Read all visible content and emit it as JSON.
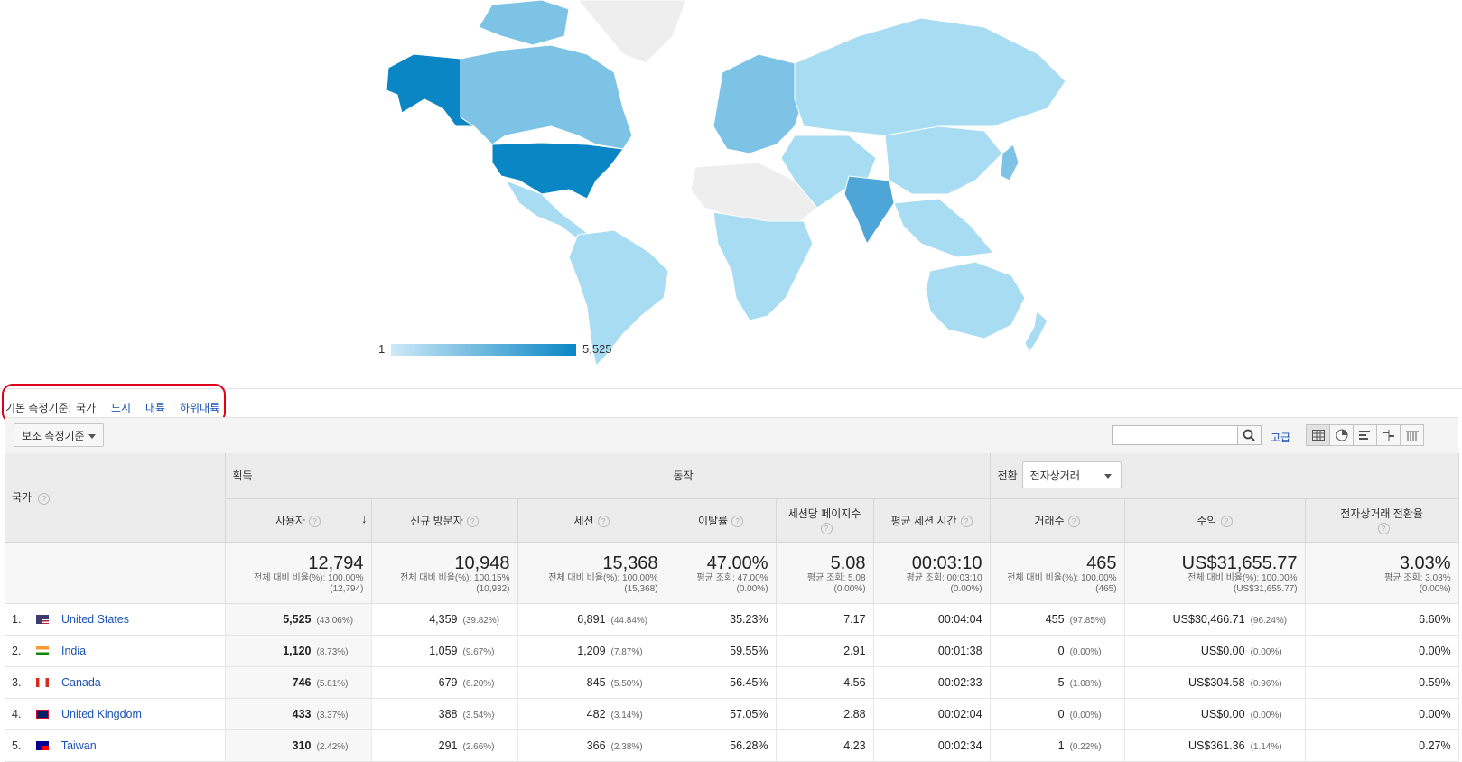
{
  "map": {
    "legend_min": "1",
    "legend_max": "5,525",
    "colors": {
      "low": "#cde9f7",
      "mid": "#7cc3e6",
      "high": "#0a86c5",
      "none": "#eeeeee"
    }
  },
  "primary_dimension": {
    "label": "기본 측정기준:",
    "current": "국가",
    "options": [
      "도시",
      "대륙",
      "하위대륙"
    ]
  },
  "toolbar": {
    "secondary_dimension": "보조 측정기준",
    "search_placeholder": "",
    "advanced": "고급"
  },
  "table": {
    "dimension_header": "국가",
    "groups": [
      "획득",
      "동작",
      "전환"
    ],
    "conversion_select": "전자상거래",
    "columns": [
      "사용자",
      "신규 방문자",
      "세션",
      "이탈률",
      "세션당 페이지수",
      "평균 세션 시간",
      "거래수",
      "수익",
      "전자상거래 전환율"
    ],
    "totals": [
      {
        "value": "12,794",
        "sub1": "전체 대비 비율(%): 100.00%",
        "sub2": "(12,794)"
      },
      {
        "value": "10,948",
        "sub1": "전체 대비 비율(%): 100.15%",
        "sub2": "(10,932)"
      },
      {
        "value": "15,368",
        "sub1": "전체 대비 비율(%): 100.00%",
        "sub2": "(15,368)"
      },
      {
        "value": "47.00%",
        "sub1": "평균 조회: 47.00%",
        "sub2": "(0.00%)"
      },
      {
        "value": "5.08",
        "sub1": "평균 조회: 5.08",
        "sub2": "(0.00%)"
      },
      {
        "value": "00:03:10",
        "sub1": "평균 조회: 00:03:10",
        "sub2": "(0.00%)"
      },
      {
        "value": "465",
        "sub1": "전체 대비 비율(%): 100.00%",
        "sub2": "(465)"
      },
      {
        "value": "US$31,655.77",
        "sub1": "전체 대비 비율(%): 100.00%",
        "sub2": "(US$31,655.77)"
      },
      {
        "value": "3.03%",
        "sub1": "평균 조회: 3.03%",
        "sub2": "(0.00%)"
      }
    ],
    "rows": [
      {
        "rank": "1.",
        "country": "United States",
        "flag": "us",
        "users": "5,525",
        "users_pct": "(43.06%)",
        "new": "4,359",
        "new_pct": "(39.82%)",
        "sessions": "6,891",
        "sessions_pct": "(44.84%)",
        "bounce": "35.23%",
        "pages": "7.17",
        "duration": "00:04:04",
        "transactions": "455",
        "transactions_pct": "(97.85%)",
        "revenue": "US$30,466.71",
        "revenue_pct": "(96.24%)",
        "conversion": "6.60%"
      },
      {
        "rank": "2.",
        "country": "India",
        "flag": "in",
        "users": "1,120",
        "users_pct": "(8.73%)",
        "new": "1,059",
        "new_pct": "(9.67%)",
        "sessions": "1,209",
        "sessions_pct": "(7.87%)",
        "bounce": "59.55%",
        "pages": "2.91",
        "duration": "00:01:38",
        "transactions": "0",
        "transactions_pct": "(0.00%)",
        "revenue": "US$0.00",
        "revenue_pct": "(0.00%)",
        "conversion": "0.00%"
      },
      {
        "rank": "3.",
        "country": "Canada",
        "flag": "ca",
        "users": "746",
        "users_pct": "(5.81%)",
        "new": "679",
        "new_pct": "(6.20%)",
        "sessions": "845",
        "sessions_pct": "(5.50%)",
        "bounce": "56.45%",
        "pages": "4.56",
        "duration": "00:02:33",
        "transactions": "5",
        "transactions_pct": "(1.08%)",
        "revenue": "US$304.58",
        "revenue_pct": "(0.96%)",
        "conversion": "0.59%"
      },
      {
        "rank": "4.",
        "country": "United Kingdom",
        "flag": "gb",
        "users": "433",
        "users_pct": "(3.37%)",
        "new": "388",
        "new_pct": "(3.54%)",
        "sessions": "482",
        "sessions_pct": "(3.14%)",
        "bounce": "57.05%",
        "pages": "2.88",
        "duration": "00:02:04",
        "transactions": "0",
        "transactions_pct": "(0.00%)",
        "revenue": "US$0.00",
        "revenue_pct": "(0.00%)",
        "conversion": "0.00%"
      },
      {
        "rank": "5.",
        "country": "Taiwan",
        "flag": "tw",
        "users": "310",
        "users_pct": "(2.42%)",
        "new": "291",
        "new_pct": "(2.66%)",
        "sessions": "366",
        "sessions_pct": "(2.38%)",
        "bounce": "56.28%",
        "pages": "4.23",
        "duration": "00:02:34",
        "transactions": "1",
        "transactions_pct": "(0.22%)",
        "revenue": "US$361.36",
        "revenue_pct": "(1.14%)",
        "conversion": "0.27%"
      }
    ]
  }
}
